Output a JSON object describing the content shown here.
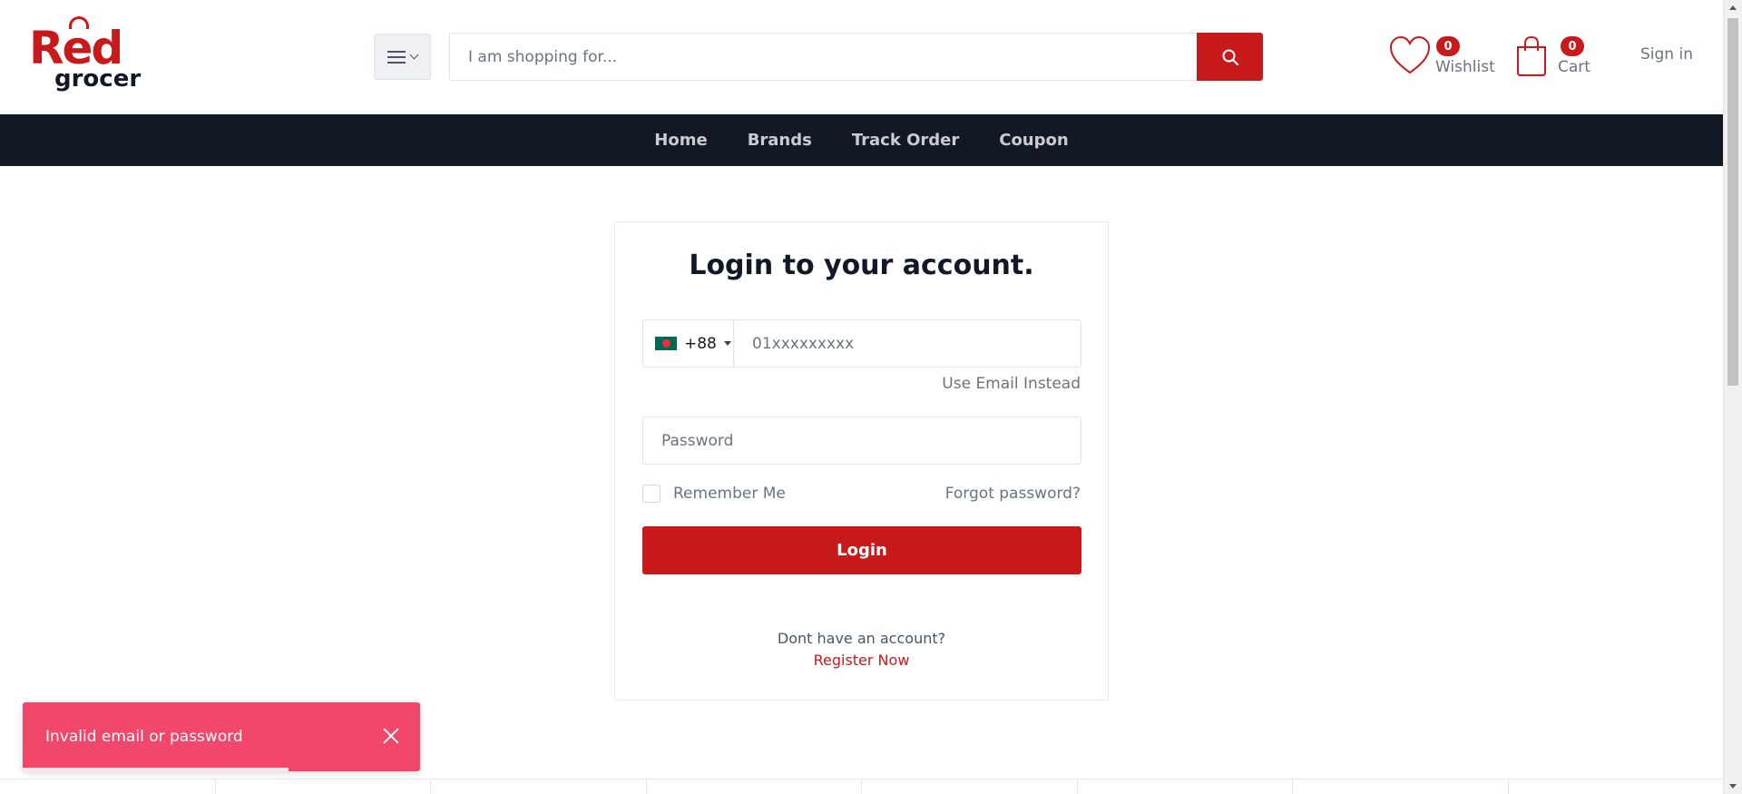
{
  "brand": {
    "logo_top": "Red",
    "logo_bottom": "grocer",
    "accent_color": "#c8191b"
  },
  "header": {
    "search_placeholder": "I am shopping for...",
    "wishlist_label": "Wishlist",
    "wishlist_count": "0",
    "cart_label": "Cart",
    "cart_count": "0",
    "signin_label": "Sign in"
  },
  "nav": {
    "items": [
      {
        "label": "Home"
      },
      {
        "label": "Brands"
      },
      {
        "label": "Track Order"
      },
      {
        "label": "Coupon"
      }
    ]
  },
  "login": {
    "title": "Login to your account.",
    "country_code": "+88",
    "phone_placeholder": "01xxxxxxxxx",
    "use_email_label": "Use Email Instead",
    "password_placeholder": "Password",
    "remember_label": "Remember Me",
    "remember_checked": false,
    "forgot_label": "Forgot password?",
    "login_button_label": "Login",
    "no_account_text": "Dont have an account?",
    "register_label": "Register Now"
  },
  "toast": {
    "message": "Invalid email or password",
    "progress": 0.67,
    "color": "#f0476a"
  }
}
